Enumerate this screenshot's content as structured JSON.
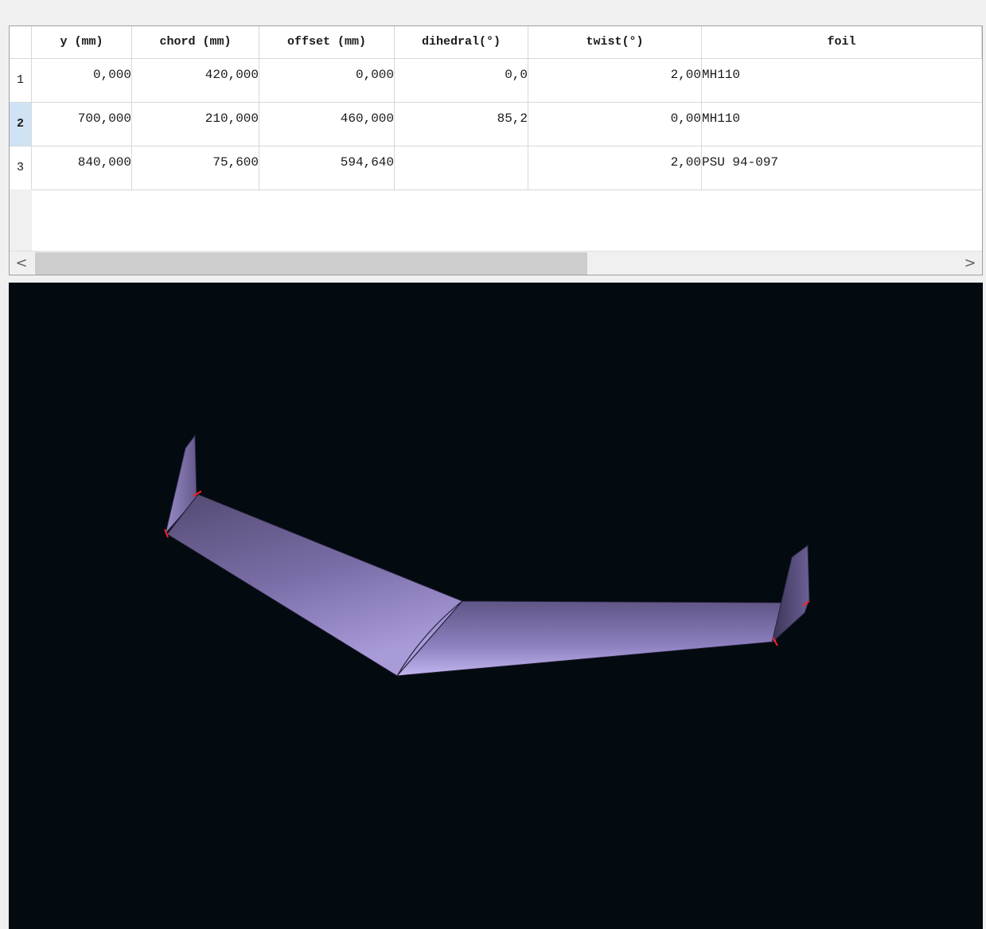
{
  "table": {
    "columns": [
      "y (mm)",
      "chord (mm)",
      "offset (mm)",
      "dihedral(°)",
      "twist(°)",
      "foil"
    ],
    "rows": [
      {
        "index": "1",
        "y": "0,000",
        "chord": "420,000",
        "offset": "0,000",
        "dihedral": "0,0",
        "twist": "2,00",
        "foil": "MH110"
      },
      {
        "index": "2",
        "y": "700,000",
        "chord": "210,000",
        "offset": "460,000",
        "dihedral": "85,2",
        "twist": "0,00",
        "foil": "MH110"
      },
      {
        "index": "3",
        "y": "840,000",
        "chord": "75,600",
        "offset": "594,640",
        "dihedral": "",
        "twist": "2,00",
        "foil": "PSU 94-097"
      }
    ],
    "selected_row": "2"
  },
  "scrollbar": {
    "left_arrow": "<",
    "right_arrow": ">"
  },
  "viewport": {
    "background": "#030a10",
    "wing_color": "#8d80c0",
    "section_marker_color": "#ff2020"
  }
}
